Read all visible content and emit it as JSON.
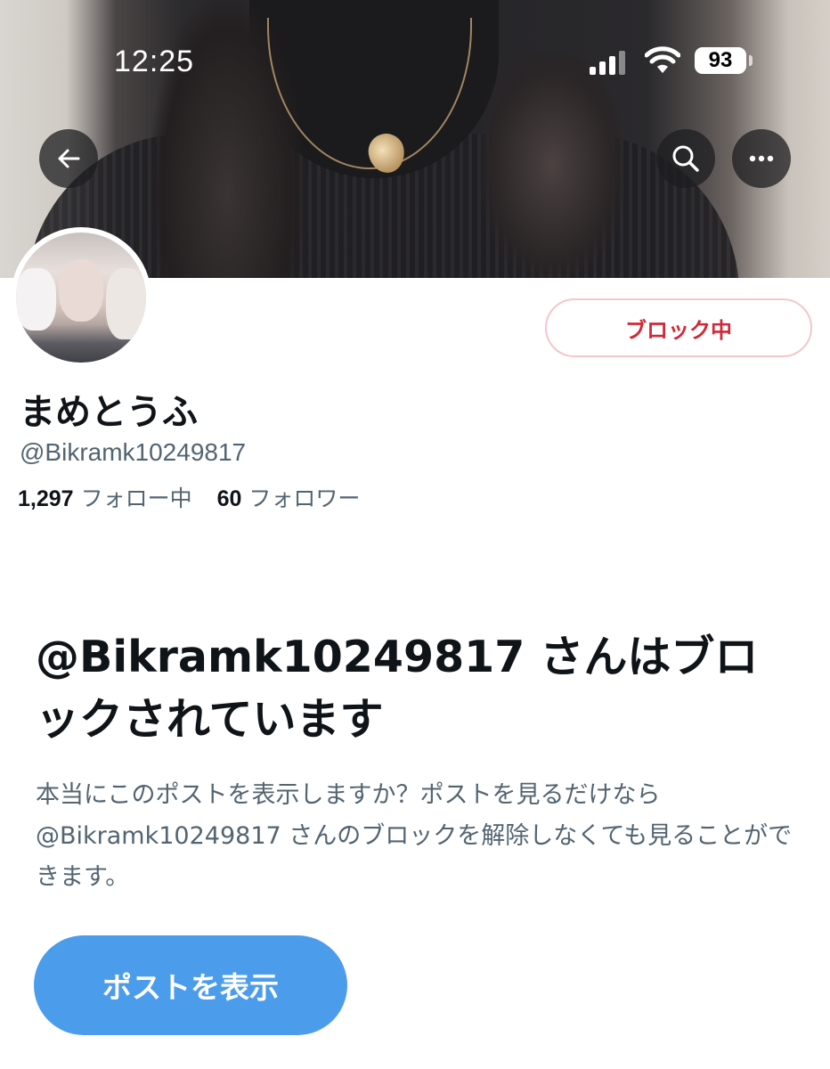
{
  "status_bar": {
    "time": "12:25",
    "battery": "93"
  },
  "header": {
    "back_icon": "arrow-left-icon",
    "search_icon": "search-icon",
    "more_icon": "more-horizontal-icon"
  },
  "profile": {
    "display_name": "まめとうふ",
    "handle": "@Bikramk10249817",
    "following_count": "1,297",
    "following_label": "フォロー中",
    "followers_count": "60",
    "followers_label": "フォロワー",
    "block_button_label": "ブロック中"
  },
  "blocked_notice": {
    "title": "@Bikramk10249817 さんはブロックされています",
    "description": "本当にこのポストを表示しますか？ポストを見るだけなら@Bikramk10249817 さんのブロックを解除しなくても見ることができます。",
    "view_button_label": "ポストを表示"
  },
  "colors": {
    "block_red": "#d42737",
    "block_border": "#f4c6cc",
    "primary_blue": "#4c9cec",
    "secondary_text": "#536471"
  }
}
